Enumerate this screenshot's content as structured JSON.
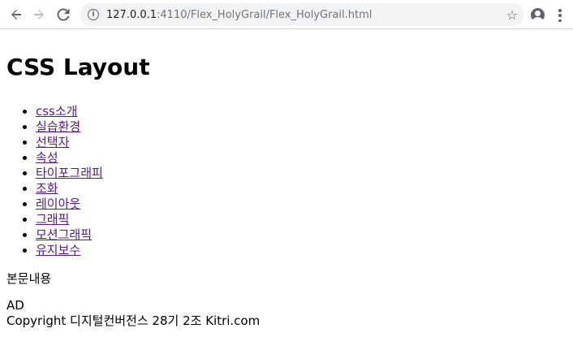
{
  "browser": {
    "url_host": "127.0.0.1",
    "url_rest": ":4110/Flex_HolyGrail/Flex_HolyGrail.html",
    "icons": [
      "back-icon",
      "forward-icon",
      "reload-icon",
      "info-icon",
      "star-icon",
      "profile-icon",
      "menu-icon"
    ]
  },
  "page": {
    "title": "CSS Layout",
    "nav_items": [
      "css소개",
      "실습환경",
      "선택자",
      "속성",
      "타이포그래피",
      "조화",
      "레이아웃",
      "그래픽",
      "모션그래픽",
      "유지보수"
    ],
    "content": "본문내용",
    "ad": "AD",
    "footer": "Copyright 디지털컨버전스 28기 2조 Kitri.com"
  }
}
